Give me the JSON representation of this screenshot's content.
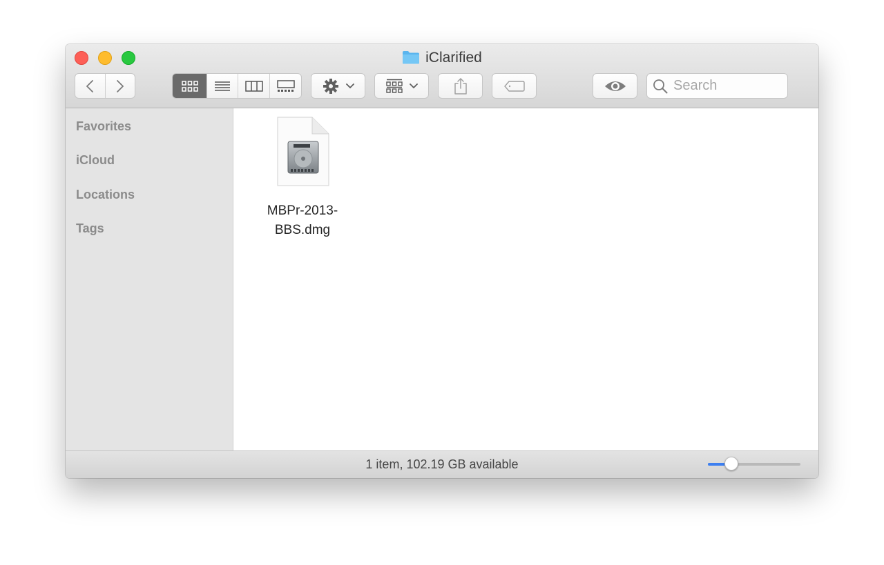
{
  "window": {
    "title": "iClarified",
    "title_icon": "folder-icon",
    "traffic_lights": {
      "close": "#fd5f57",
      "minimize": "#febc2e",
      "zoom": "#29c840"
    }
  },
  "toolbar": {
    "back_icon": "chevron-left-icon",
    "forward_icon": "chevron-right-icon",
    "view_modes": [
      {
        "id": "icon",
        "icon": "icon-view-icon",
        "active": true
      },
      {
        "id": "list",
        "icon": "list-view-icon",
        "active": false
      },
      {
        "id": "column",
        "icon": "column-view-icon",
        "active": false
      },
      {
        "id": "gallery",
        "icon": "gallery-view-icon",
        "active": false
      }
    ],
    "action_icon": "gear-icon",
    "group_icon": "group-by-icon",
    "share_icon": "share-icon",
    "tag_icon": "tag-icon",
    "quicklook_icon": "eye-icon",
    "search": {
      "placeholder": "Search",
      "value": ""
    }
  },
  "sidebar": {
    "items": [
      {
        "label": "Favorites"
      },
      {
        "label": "iCloud"
      },
      {
        "label": "Locations"
      },
      {
        "label": "Tags"
      }
    ]
  },
  "content": {
    "files": [
      {
        "name_line1": "MBPr-2013-",
        "name_line2": "BBS.dmg",
        "icon": "disk-image-icon"
      }
    ]
  },
  "statusbar": {
    "text": "1 item, 102.19 GB available",
    "icon_size_level": 0.25,
    "accent": "#3d7ff0"
  }
}
